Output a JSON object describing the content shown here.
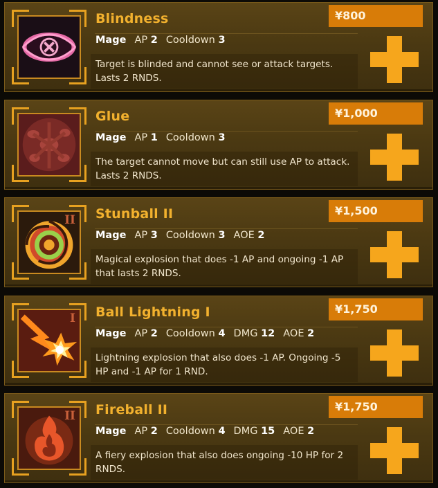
{
  "stats_labels": {
    "ap": "AP",
    "cooldown": "Cooldown",
    "dmg": "DMG",
    "aoe": "AOE"
  },
  "spells": [
    {
      "name": "Blindness",
      "rank": "",
      "class": "Mage",
      "ap": "2",
      "cooldown": "3",
      "dmg": "",
      "aoe": "",
      "price": "¥800",
      "description": "Target is blinded and cannot see or attack targets. Lasts 2 RNDS.",
      "icon": "blind-eye-icon"
    },
    {
      "name": "Glue",
      "rank": "",
      "class": "Mage",
      "ap": "1",
      "cooldown": "3",
      "dmg": "",
      "aoe": "",
      "price": "¥1,000",
      "description": "The target cannot move but can still use AP to attack. Lasts 2 RNDS.",
      "icon": "glue-icon"
    },
    {
      "name": "Stunball II",
      "rank": "II",
      "class": "Mage",
      "ap": "3",
      "cooldown": "3",
      "dmg": "",
      "aoe": "2",
      "price": "¥1,500",
      "description": "Magical explosion that does -1 AP and ongoing -1 AP that lasts 2 RNDS.",
      "icon": "spiral-icon"
    },
    {
      "name": "Ball Lightning I",
      "rank": "I",
      "class": "Mage",
      "ap": "2",
      "cooldown": "4",
      "dmg": "12",
      "aoe": "2",
      "price": "¥1,750",
      "description": "Lightning explosion that also does -1 AP. Ongoing -5 HP and -1 AP for 1 RND.",
      "icon": "lightning-burst-icon"
    },
    {
      "name": "Fireball II",
      "rank": "II",
      "class": "Mage",
      "ap": "2",
      "cooldown": "4",
      "dmg": "15",
      "aoe": "2",
      "price": "¥1,750",
      "description": "A fiery explosion that also does ongoing -10 HP for 2 RNDS.",
      "icon": "flame-icon"
    }
  ]
}
